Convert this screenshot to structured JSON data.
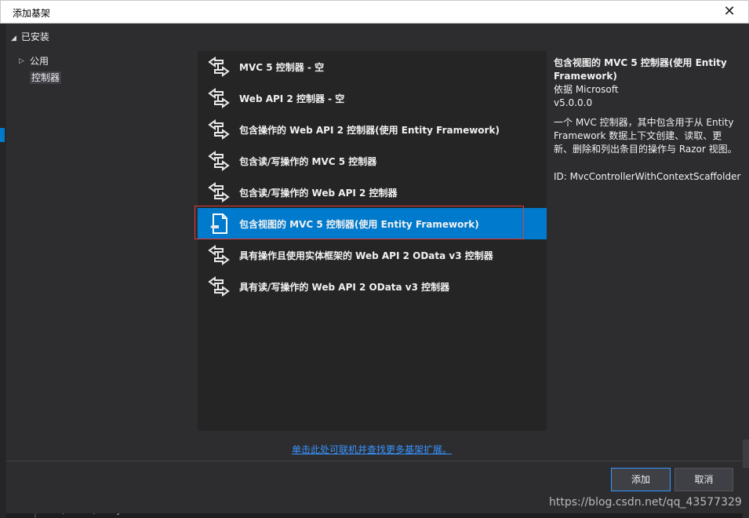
{
  "window": {
    "title": "添加基架",
    "close_glyph": "✕"
  },
  "sidebar": {
    "installed_label": "已安装",
    "items": [
      {
        "label": "公用"
      },
      {
        "label": "控制器"
      }
    ]
  },
  "templates": [
    {
      "label": "MVC 5 控制器 - 空"
    },
    {
      "label": "Web API 2 控制器 - 空"
    },
    {
      "label": "包含操作的 Web API 2 控制器(使用 Entity Framework)"
    },
    {
      "label": "包含读/写操作的 MVC 5 控制器"
    },
    {
      "label": "包含读/写操作的 Web API 2 控制器"
    },
    {
      "label": "包含视图的 MVC 5 控制器(使用 Entity Framework)",
      "selected": true
    },
    {
      "label": "具有操作且使用实体框架的 Web API 2 OData v3 控制器"
    },
    {
      "label": "具有读/写操作的 Web API 2 OData v3 控制器"
    }
  ],
  "details": {
    "title": "包含视图的 MVC 5 控制器(使用 Entity Framework)",
    "author": "依据 Microsoft",
    "version": "v5.0.0.0",
    "description": "一个 MVC 控制器，其中包含用于从 Entity Framework 数据上下文创建、读取、更新、删除和列出条目的操作与 Razor 视图。",
    "id": "ID: MvcControllerWithContextScaffolder"
  },
  "online_link": "单击此处可联机并查找更多基架扩展。",
  "buttons": {
    "add": "添加",
    "cancel": "取消"
  },
  "background": {
    "path_text": "C:\\Users\\fancy55"
  },
  "watermark": "https://blog.csdn.net/qq_43577329",
  "colors": {
    "accent": "#007acc",
    "selection_outline": "#e03c3c",
    "link": "#3794ff"
  }
}
